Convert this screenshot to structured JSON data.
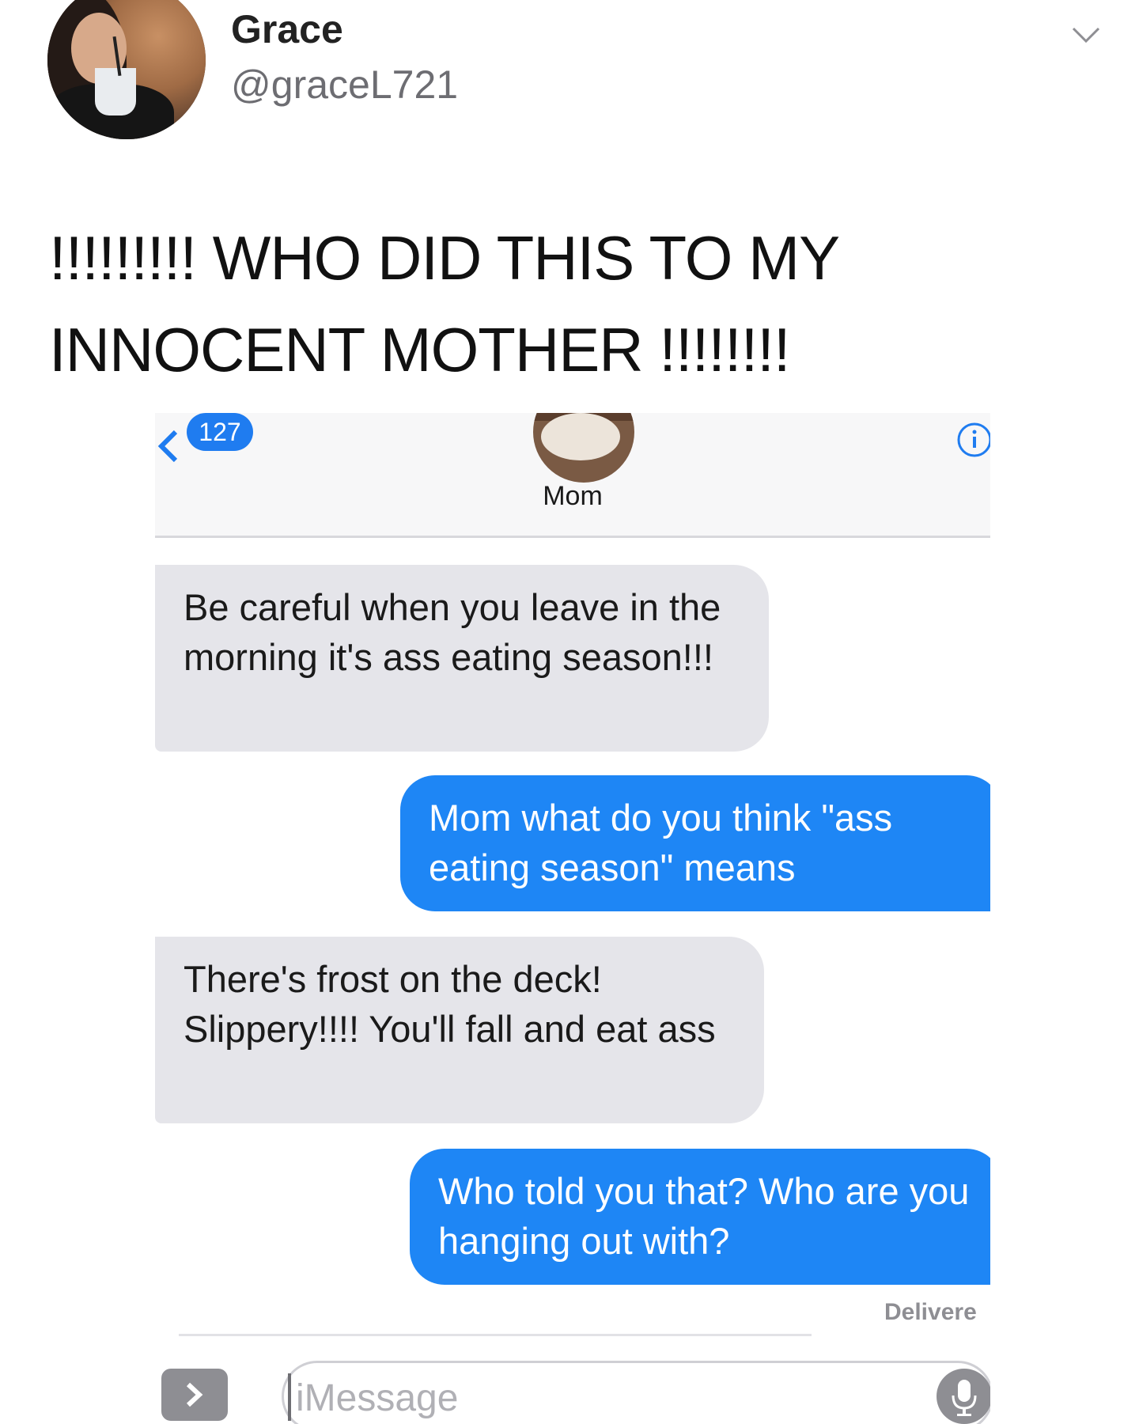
{
  "tweet": {
    "user_name": "Grace",
    "user_handle": "@graceL721",
    "text_line1": "!!!!!!!!! WHO DID THIS TO MY",
    "text_line2": "INNOCENT MOTHER !!!!!!!!",
    "menu_icon": "chevron-down-icon"
  },
  "screenshot": {
    "unread_count": "127",
    "contact_name": "Mom",
    "messages": [
      {
        "direction": "incoming",
        "text": "Be careful when you leave in the morning it's ass eating season!!!"
      },
      {
        "direction": "outgoing",
        "text": "Mom what do you think \"ass eating season\" means"
      },
      {
        "direction": "incoming",
        "text": "There's frost on the deck! Slippery!!!! You'll fall and eat ass"
      },
      {
        "direction": "outgoing",
        "text": "Who told you that? Who are you hanging out with?"
      }
    ],
    "status": "Delivere",
    "input_placeholder": "iMessage",
    "colors": {
      "incoming_bubble": "#e5e5ea",
      "outgoing_bubble": "#1e86f5",
      "badge": "#1f7cf0"
    }
  }
}
